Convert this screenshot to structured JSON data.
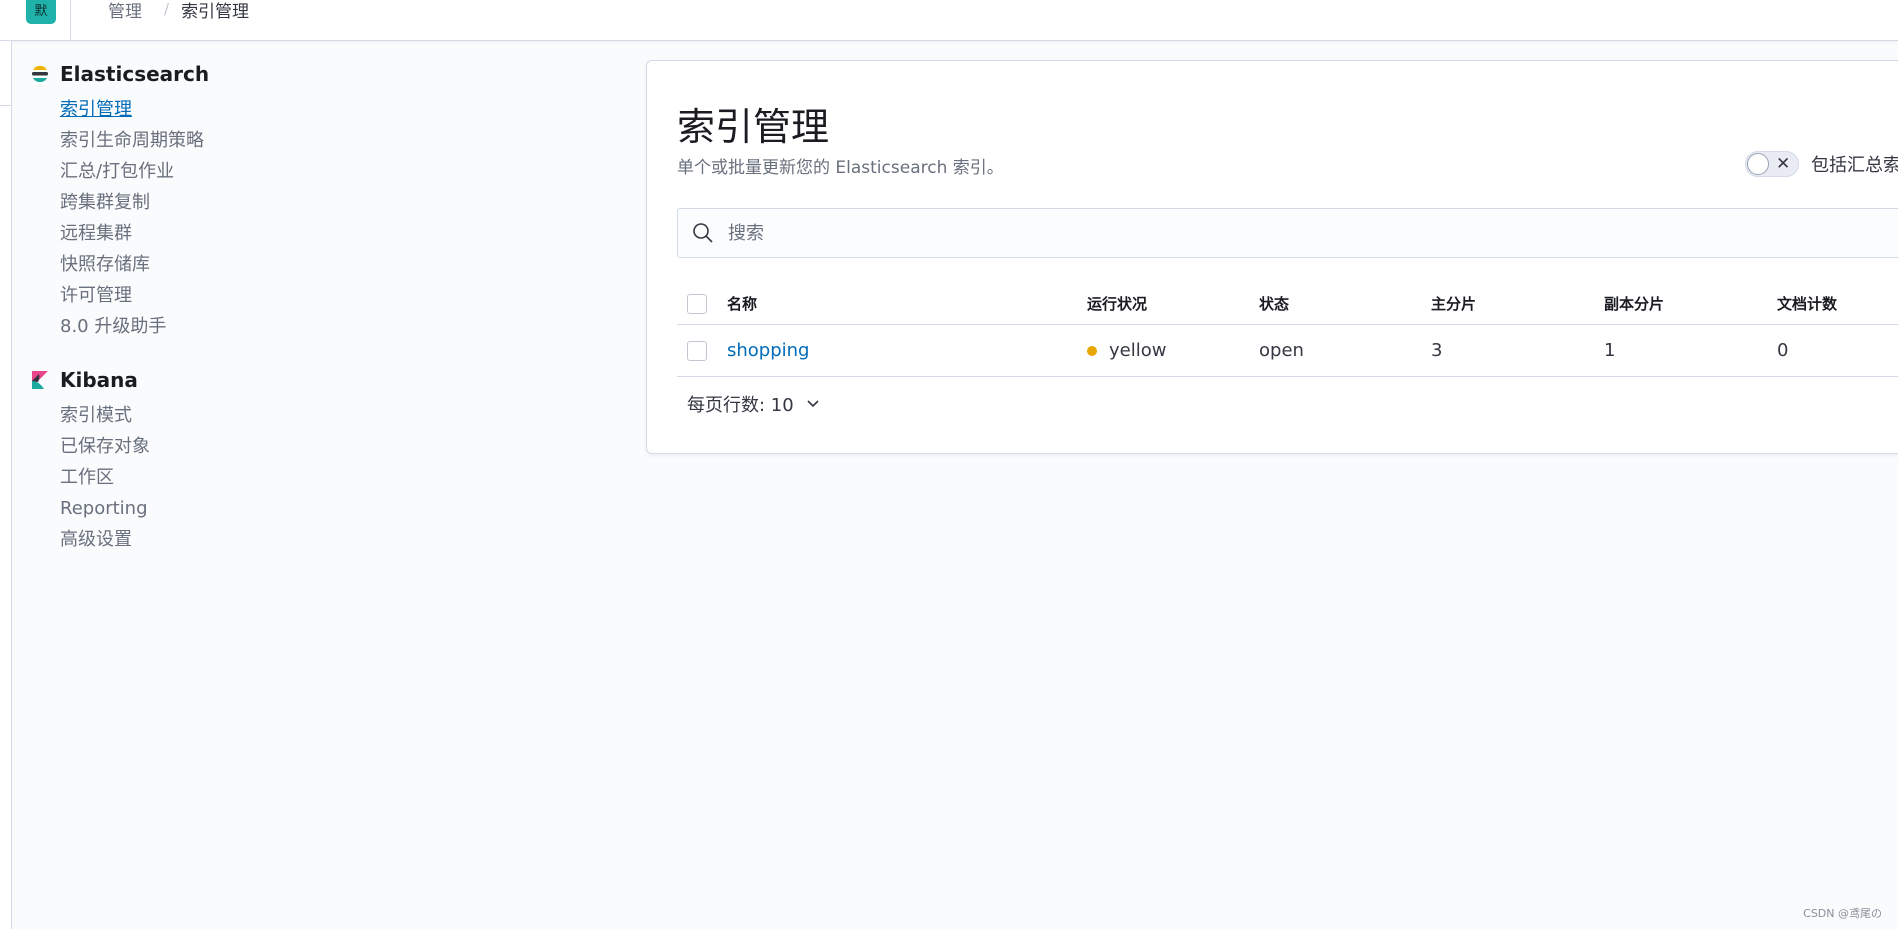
{
  "header": {
    "space_avatar": "默",
    "breadcrumbs": [
      "管理",
      "索引管理"
    ],
    "breadcrumb_sep": "/"
  },
  "sidebar": {
    "sections": [
      {
        "title": "Elasticsearch",
        "icon": "elasticsearch-logo-icon",
        "items": [
          "索引管理",
          "索引生命周期策略",
          "汇总/打包作业",
          "跨集群复制",
          "远程集群",
          "快照存储库",
          "许可管理",
          "8.0 升级助手"
        ]
      },
      {
        "title": "Kibana",
        "icon": "kibana-logo-icon",
        "items": [
          "索引模式",
          "已保存对象",
          "工作区",
          "Reporting",
          "高级设置"
        ]
      }
    ],
    "active_item": "索引管理"
  },
  "main": {
    "title": "索引管理",
    "description": "单个或批量更新您的 Elasticsearch 索引。",
    "toggle": {
      "label": "包括汇总索",
      "checked": false,
      "icon": "cross-icon"
    },
    "search": {
      "placeholder": "搜索",
      "value": ""
    },
    "table": {
      "columns": [
        "名称",
        "运行状况",
        "状态",
        "主分片",
        "副本分片",
        "文档计数"
      ],
      "rows": [
        {
          "name": "shopping",
          "health": "yellow",
          "status": "open",
          "primary": "3",
          "replica": "1",
          "docs": "0"
        }
      ]
    },
    "pager": {
      "label": "每页行数: 10"
    }
  },
  "colors": {
    "accent": "#006bb8",
    "health_yellow": "#e7a700",
    "space_avatar": "#20b2aa"
  },
  "watermark": "CSDN @鸢尾の"
}
